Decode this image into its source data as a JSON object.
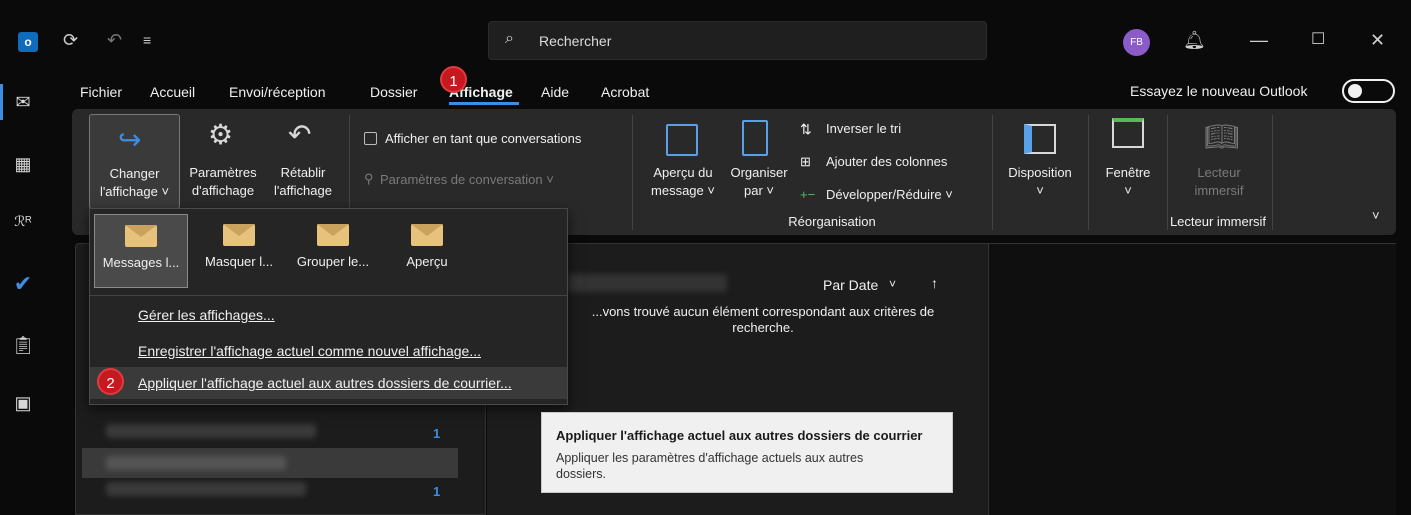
{
  "titlebar": {
    "search_placeholder": "Rechercher",
    "avatar_initials": "FB"
  },
  "menu": {
    "tabs": [
      "Fichier",
      "Accueil",
      "Envoi/réception",
      "Dossier",
      "Affichage",
      "Aide",
      "Acrobat"
    ],
    "try_new": "Essayez le nouveau Outlook"
  },
  "ribbon": {
    "change_view": [
      "Changer",
      "l'affichage ˅"
    ],
    "view_settings": [
      "Paramètres",
      "d'affichage"
    ],
    "reset_view": [
      "Rétablir",
      "l'affichage"
    ],
    "show_conversations": "Afficher en tant que conversations",
    "conversation_settings": "Paramètres de conversation ˅",
    "reading_pane": [
      "Aperçu du",
      "message ˅"
    ],
    "arrange_by": [
      "Organiser",
      "par ˅"
    ],
    "reverse_sort": "Inverser le tri",
    "add_columns": "Ajouter des colonnes",
    "expand_collapse": "Développer/Réduire ˅",
    "arrangement_group": "Réorganisation",
    "layout": "Disposition",
    "window": "Fenêtre",
    "immersive_reader": [
      "Lecteur",
      "immersif"
    ],
    "immersive_group": "Lecteur immersif"
  },
  "list": {
    "sort_label": "Par Date",
    "empty_message": [
      "...vons trouvé aucun élément correspondant aux critères de",
      "recherche."
    ],
    "count_1": "1",
    "count_2": "1"
  },
  "dropdown": {
    "views": [
      "Messages l...",
      "Masquer l...",
      "Grouper le...",
      "Aperçu"
    ],
    "manage_views": "Gérer les affichages...",
    "save_view": "Enregistrer l'affichage actuel comme nouvel affichage...",
    "apply_view": "Appliquer l'affichage actuel aux autres dossiers de courrier..."
  },
  "tooltip": {
    "title": "Appliquer l'affichage actuel aux autres dossiers de courrier",
    "body": [
      "Appliquer les paramètres d'affichage actuels aux autres",
      "dossiers."
    ]
  },
  "annotations": {
    "badge_1": "1",
    "badge_2": "2"
  },
  "colors": {
    "accent": "#3d8de0",
    "badge": "#c4191f"
  }
}
